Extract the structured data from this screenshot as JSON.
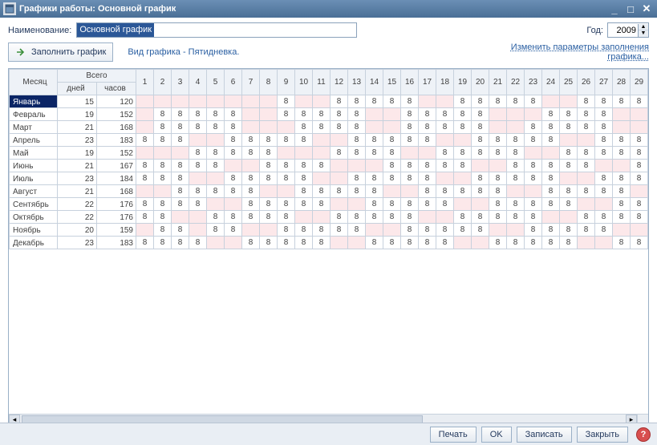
{
  "title": "Графики работы: Основной график",
  "labels": {
    "name": "Наименование:",
    "year": "Год:",
    "fill": "Заполнить график",
    "schedule_type": "Вид графика - Пятидневка.",
    "edit_params": "Изменить параметры заполнения графика..."
  },
  "name_value": "Основной график",
  "year_value": "2009",
  "headers": {
    "month": "Месяц",
    "total": "Всего",
    "days": "дней",
    "hours": "часов"
  },
  "day_cols": [
    "1",
    "2",
    "3",
    "4",
    "5",
    "6",
    "7",
    "8",
    "9",
    "10",
    "11",
    "12",
    "13",
    "14",
    "15",
    "16",
    "17",
    "18",
    "19",
    "20",
    "21",
    "22",
    "23",
    "24",
    "25",
    "26",
    "27",
    "28",
    "29"
  ],
  "months": [
    {
      "name": "Январь",
      "days": 15,
      "hours": 120,
      "cells": [
        "",
        "",
        "",
        "",
        "",
        "",
        "",
        "",
        "8",
        "",
        "",
        "8",
        "8",
        "8",
        "8",
        "8",
        "",
        "",
        "8",
        "8",
        "8",
        "8",
        "8",
        "",
        "",
        "8",
        "8",
        "8",
        "8"
      ]
    },
    {
      "name": "Февраль",
      "days": 19,
      "hours": 152,
      "cells": [
        "",
        "8",
        "8",
        "8",
        "8",
        "8",
        "",
        "",
        "8",
        "8",
        "8",
        "8",
        "8",
        "",
        "",
        "8",
        "8",
        "8",
        "8",
        "8",
        "",
        "",
        "",
        "8",
        "8",
        "8",
        "8",
        "",
        ""
      ]
    },
    {
      "name": "Март",
      "days": 21,
      "hours": 168,
      "cells": [
        "",
        "8",
        "8",
        "8",
        "8",
        "8",
        "",
        "",
        "",
        "8",
        "8",
        "8",
        "8",
        "",
        "",
        "8",
        "8",
        "8",
        "8",
        "8",
        "",
        "",
        "8",
        "8",
        "8",
        "8",
        "8",
        "",
        ""
      ]
    },
    {
      "name": "Апрель",
      "days": 23,
      "hours": 183,
      "cells": [
        "8",
        "8",
        "8",
        "",
        "",
        "8",
        "8",
        "8",
        "8",
        "8",
        "",
        "",
        "8",
        "8",
        "8",
        "8",
        "8",
        "",
        "",
        "8",
        "8",
        "8",
        "8",
        "8",
        "",
        "",
        "8",
        "8",
        "8"
      ]
    },
    {
      "name": "Май",
      "days": 19,
      "hours": 152,
      "cells": [
        "",
        "",
        "",
        "8",
        "8",
        "8",
        "8",
        "8",
        "",
        "",
        "",
        "8",
        "8",
        "8",
        "8",
        "",
        "",
        "8",
        "8",
        "8",
        "8",
        "8",
        "",
        "",
        "8",
        "8",
        "8",
        "8",
        "8"
      ]
    },
    {
      "name": "Июнь",
      "days": 21,
      "hours": 167,
      "cells": [
        "8",
        "8",
        "8",
        "8",
        "8",
        "",
        "",
        "8",
        "8",
        "8",
        "8",
        "",
        "",
        "",
        "8",
        "8",
        "8",
        "8",
        "8",
        "",
        "",
        "8",
        "8",
        "8",
        "8",
        "8",
        "",
        "",
        "8"
      ]
    },
    {
      "name": "Июль",
      "days": 23,
      "hours": 184,
      "cells": [
        "8",
        "8",
        "8",
        "",
        "",
        "8",
        "8",
        "8",
        "8",
        "8",
        "",
        "",
        "8",
        "8",
        "8",
        "8",
        "8",
        "",
        "",
        "8",
        "8",
        "8",
        "8",
        "8",
        "",
        "",
        "8",
        "8",
        "8"
      ]
    },
    {
      "name": "Август",
      "days": 21,
      "hours": 168,
      "cells": [
        "",
        "",
        "8",
        "8",
        "8",
        "8",
        "8",
        "",
        "",
        "8",
        "8",
        "8",
        "8",
        "8",
        "",
        "",
        "8",
        "8",
        "8",
        "8",
        "8",
        "",
        "",
        "8",
        "8",
        "8",
        "8",
        "8",
        ""
      ]
    },
    {
      "name": "Сентябрь",
      "days": 22,
      "hours": 176,
      "cells": [
        "8",
        "8",
        "8",
        "8",
        "",
        "",
        "8",
        "8",
        "8",
        "8",
        "8",
        "",
        "",
        "8",
        "8",
        "8",
        "8",
        "8",
        "",
        "",
        "8",
        "8",
        "8",
        "8",
        "8",
        "",
        "",
        "8",
        "8"
      ]
    },
    {
      "name": "Октябрь",
      "days": 22,
      "hours": 176,
      "cells": [
        "8",
        "8",
        "",
        "",
        "8",
        "8",
        "8",
        "8",
        "8",
        "",
        "",
        "8",
        "8",
        "8",
        "8",
        "8",
        "",
        "",
        "8",
        "8",
        "8",
        "8",
        "8",
        "",
        "",
        "8",
        "8",
        "8",
        "8"
      ]
    },
    {
      "name": "Ноябрь",
      "days": 20,
      "hours": 159,
      "cells": [
        "",
        "8",
        "8",
        "",
        "8",
        "8",
        "",
        "",
        "8",
        "8",
        "8",
        "8",
        "8",
        "",
        "",
        "8",
        "8",
        "8",
        "8",
        "8",
        "",
        "",
        "8",
        "8",
        "8",
        "8",
        "8",
        "",
        ""
      ]
    },
    {
      "name": "Декабрь",
      "days": 23,
      "hours": 183,
      "cells": [
        "8",
        "8",
        "8",
        "8",
        "",
        "",
        "8",
        "8",
        "8",
        "8",
        "8",
        "",
        "",
        "8",
        "8",
        "8",
        "8",
        "8",
        "",
        "",
        "8",
        "8",
        "8",
        "8",
        "8",
        "",
        "",
        "8",
        "8"
      ]
    }
  ],
  "footer": {
    "print": "Печать",
    "ok": "OK",
    "save": "Записать",
    "close": "Закрыть"
  }
}
